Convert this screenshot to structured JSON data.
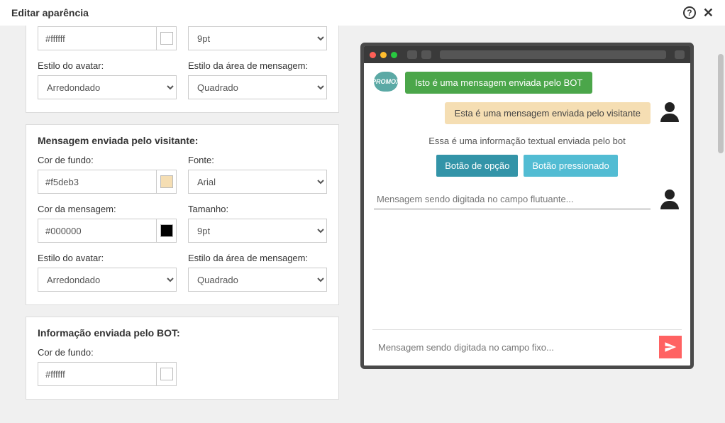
{
  "header": {
    "title": "Editar aparência"
  },
  "top_panel": {
    "color_value": "#ffffff",
    "swatch": "#ffffff",
    "size_value": "9pt",
    "avatar_label": "Estilo do avatar:",
    "avatar_value": "Arredondado",
    "msgarea_label": "Estilo da área de mensagem:",
    "msgarea_value": "Quadrado"
  },
  "visitor_panel": {
    "title": "Mensagem enviada pelo visitante:",
    "bg_label": "Cor de fundo:",
    "bg_value": "#f5deb3",
    "bg_swatch": "#f5deb3",
    "font_label": "Fonte:",
    "font_value": "Arial",
    "msgcolor_label": "Cor da mensagem:",
    "msgcolor_value": "#000000",
    "msgcolor_swatch": "#000000",
    "size_label": "Tamanho:",
    "size_value": "9pt",
    "avatar_label": "Estilo do avatar:",
    "avatar_value": "Arredondado",
    "msgarea_label": "Estilo da área de mensagem:",
    "msgarea_value": "Quadrado"
  },
  "info_panel": {
    "title": "Informação enviada pelo BOT:",
    "bg_label": "Cor de fundo:",
    "bg_value": "#ffffff",
    "bg_swatch": "#ffffff"
  },
  "preview": {
    "logo_text": "PROMOX",
    "bot_msg": "Isto é uma mensagem enviada pelo BOT",
    "visitor_msg": "Esta é uma mensagem enviada pelo visitante",
    "info_text": "Essa é uma informação textual enviada pelo bot",
    "btn_option": "Botão de opção",
    "btn_pressed": "Botão pressionado",
    "float_placeholder": "Mensagem sendo digitada no campo flutuante...",
    "fixed_placeholder": "Mensagem sendo digitada no campo fixo..."
  }
}
